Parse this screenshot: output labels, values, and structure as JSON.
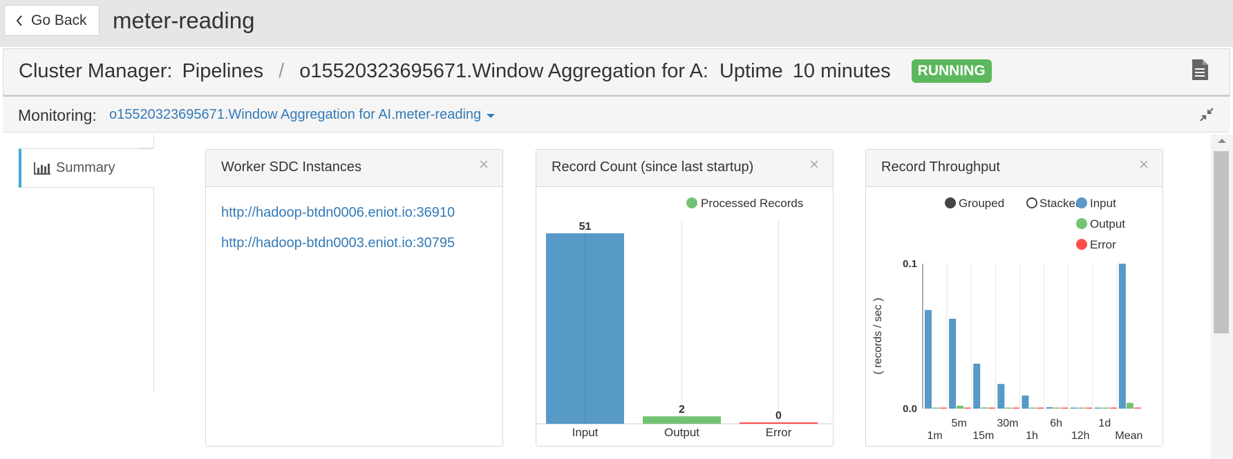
{
  "topbar": {
    "go_back_label": "Go Back",
    "app_title": "meter-reading"
  },
  "header": {
    "cluster_manager": "Cluster Manager:",
    "pipelines": "Pipelines",
    "separator": "/",
    "pipeline_name": "o15520323695671.Window Aggregation for A:",
    "uptime_label": "Uptime",
    "uptime_value": "10 minutes",
    "status": "RUNNING"
  },
  "monitoring": {
    "label": "Monitoring:",
    "selected": "o15520323695671.Window Aggregation for AI.meter-reading"
  },
  "sidebar": {
    "tabs": [
      {
        "label": "Summary",
        "icon": "bar-chart-icon"
      }
    ]
  },
  "panels": {
    "worker": {
      "title": "Worker SDC Instances",
      "close": "×",
      "links": [
        "http://hadoop-btdn0006.eniot.io:36910",
        "http://hadoop-btdn0003.eniot.io:30795"
      ]
    },
    "count": {
      "title": "Record Count (since last startup)",
      "close": "×"
    },
    "throughput": {
      "title": "Record Throughput",
      "close": "×"
    }
  },
  "colors": {
    "input": "#5799c7",
    "output": "#74c374",
    "error": "#ff4d4d",
    "accent": "#337ab7",
    "running": "#5cb85c"
  },
  "chart_data": [
    {
      "type": "bar",
      "legend": [
        "Processed Records"
      ],
      "categories": [
        "Input",
        "Output",
        "Error"
      ],
      "values": [
        51,
        2,
        0
      ],
      "ylim": [
        0,
        51
      ]
    },
    {
      "type": "bar",
      "ylabel": "( records / sec )",
      "ylim": [
        0,
        0.1
      ],
      "yticks": [
        "0.0",
        "0.1"
      ],
      "controls": [
        "Grouped",
        "Stacked"
      ],
      "categories": [
        "1m",
        "5m",
        "15m",
        "30m",
        "1h",
        "6h",
        "12h",
        "1d",
        "Mean"
      ],
      "series": [
        {
          "name": "Input",
          "values": [
            0.068,
            0.062,
            0.031,
            0.017,
            0.009,
            0.001,
            0.0005,
            0.0005,
            0.1
          ]
        },
        {
          "name": "Output",
          "values": [
            0.0005,
            0.002,
            0.0008,
            0.0003,
            0.0002,
            0.0001,
            0.0001,
            0.0001,
            0.004
          ]
        },
        {
          "name": "Error",
          "values": [
            0,
            0,
            0,
            0,
            0,
            0,
            0,
            0,
            0
          ]
        }
      ]
    }
  ]
}
